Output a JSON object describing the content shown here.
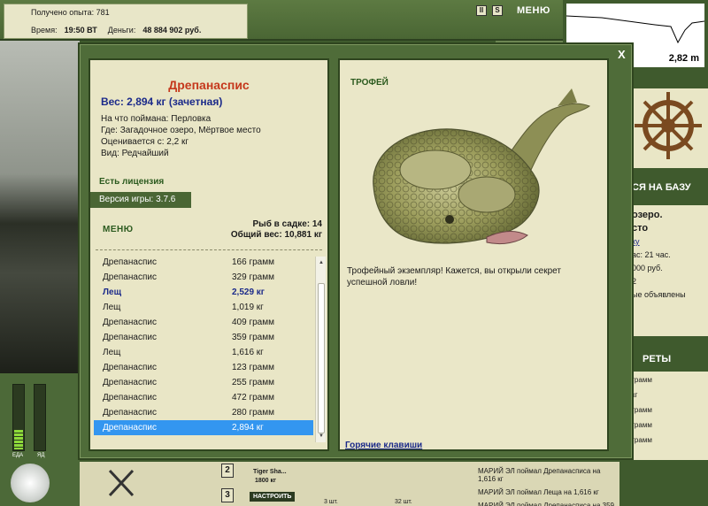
{
  "topbar": {
    "experience": "Получено опыта: 781",
    "time_label": "Время:",
    "time_value": "19:50 ВТ",
    "money_label": "Деньги:",
    "money_value": "48 884 902 руб.",
    "pause": "II",
    "sound": "S",
    "menu": "МЕНЮ"
  },
  "depth": "2,82 m",
  "right_panel": {
    "banner": "СЯ НА БАЗУ",
    "lines": [
      "озеро.",
      "сто",
      "ку",
      "ас: 21 час.",
      "000 руб.",
      "2",
      "ые объявлены"
    ],
    "secrets": "РЕТЫ",
    "log": [
      "грамм",
      "кг",
      "грамм",
      "грамм",
      "грамм"
    ]
  },
  "gauges": {
    "left": "ЕДА",
    "right": "ЯД"
  },
  "bottom": {
    "slot2": "2",
    "slot3": "3",
    "tackle": "Tiger Sha...",
    "tackle_len": "1800 кг",
    "setup": "НАСТРОИТЬ",
    "count1": "3 шт.",
    "count2": "32 шт.",
    "log": [
      "МАРИЙ ЭЛ поймал Дрепанасписа на 1,616 кг",
      "МАРИЙ ЭЛ поймал Леща на 1,616 кг",
      "МАРИЙ ЭЛ поймал Дрепанасписа на 359 грамм"
    ]
  },
  "dialog": {
    "close": "X",
    "fish_name": "Дрепанаспис",
    "weight": "Вес: 2,894 кг (зачетная)",
    "bait": "На что поймана: Перловка",
    "place": "Где: Загадочное озеро, Мёртвое место",
    "price": "Оценивается с: 2,2 кг",
    "kind": "Вид: Редчайший",
    "license": "Есть лицензия",
    "version_label": "Версия игры: ",
    "version": "3.7.6",
    "menu": "МЕНЮ",
    "keep_count": "Рыб в садке: 14",
    "keep_weight": "Общий вес: 10,881 кг",
    "catch_list": [
      {
        "name": "Дрепанаспис",
        "weight": "166 грамм"
      },
      {
        "name": "Дрепанаспис",
        "weight": "329 грамм"
      },
      {
        "name": "Лещ",
        "weight": "2,529 кг"
      },
      {
        "name": "Лещ",
        "weight": "1,019 кг"
      },
      {
        "name": "Дрепанаспис",
        "weight": "409 грамм"
      },
      {
        "name": "Дрепанаспис",
        "weight": "359 грамм"
      },
      {
        "name": "Лещ",
        "weight": "1,616 кг"
      },
      {
        "name": "Дрепанаспис",
        "weight": "123 грамм"
      },
      {
        "name": "Дрепанаспис",
        "weight": "255 грамм"
      },
      {
        "name": "Дрепанаспис",
        "weight": "472 грамм"
      },
      {
        "name": "Дрепанаспис",
        "weight": "280 грамм"
      },
      {
        "name": "Дрепанаспис",
        "weight": "2,894 кг"
      }
    ],
    "trophy_label": "ТРОФЕЙ",
    "trophy_text": "Трофейный экземпляр! Кажется, вы открыли секрет успешной ловли!",
    "hotkeys": "Горячие клавиши"
  }
}
